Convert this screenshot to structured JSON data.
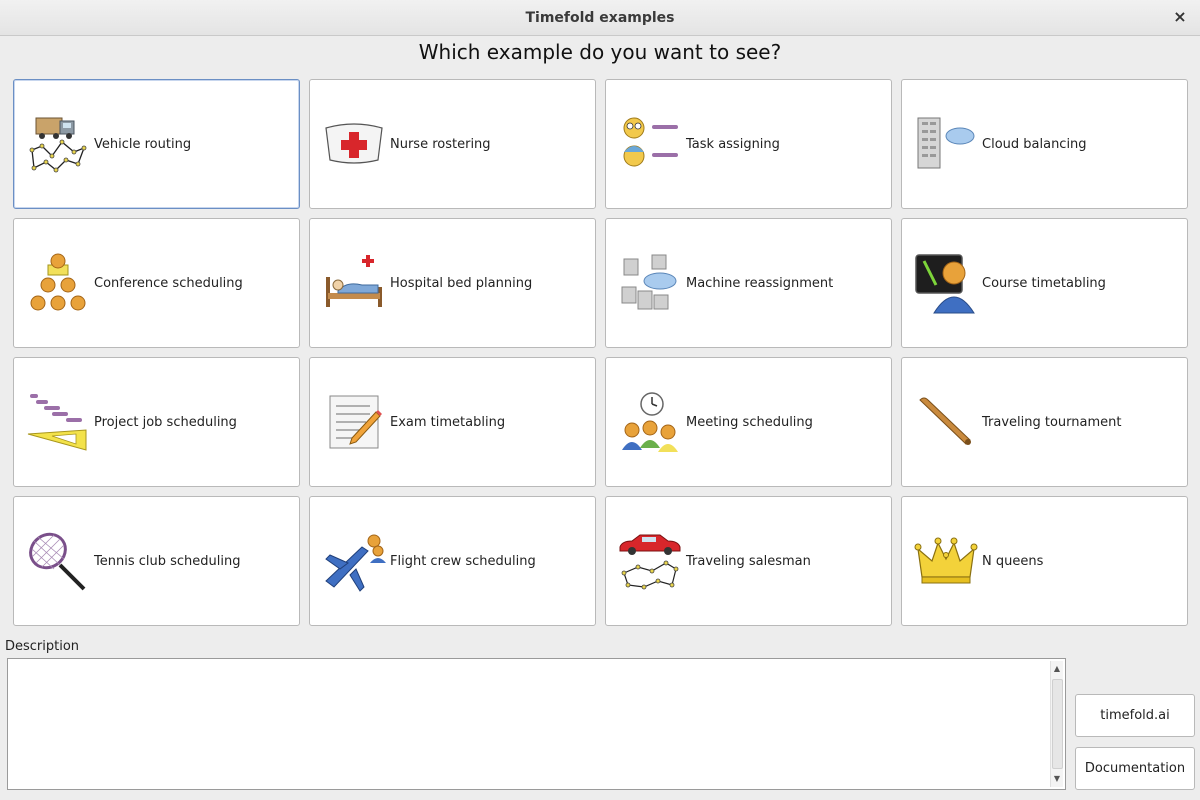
{
  "window": {
    "title": "Timefold examples",
    "close_label": "×"
  },
  "heading": "Which example do you want to see?",
  "examples": [
    {
      "label": "Vehicle routing",
      "icon": "truck-route-icon",
      "selected": true
    },
    {
      "label": "Nurse rostering",
      "icon": "nurse-cap-icon"
    },
    {
      "label": "Task assigning",
      "icon": "task-people-icon"
    },
    {
      "label": "Cloud balancing",
      "icon": "server-cloud-icon"
    },
    {
      "label": "Conference scheduling",
      "icon": "people-pyramid-icon"
    },
    {
      "label": "Hospital bed planning",
      "icon": "hospital-bed-icon"
    },
    {
      "label": "Machine reassignment",
      "icon": "servers-cloud-icon"
    },
    {
      "label": "Course timetabling",
      "icon": "teacher-blackboard-icon"
    },
    {
      "label": "Project job scheduling",
      "icon": "gantt-ruler-icon"
    },
    {
      "label": "Exam timetabling",
      "icon": "exam-paper-pencil-icon"
    },
    {
      "label": "Meeting scheduling",
      "icon": "meeting-clock-icon"
    },
    {
      "label": "Traveling tournament",
      "icon": "baseball-bat-icon"
    },
    {
      "label": "Tennis club scheduling",
      "icon": "tennis-racket-icon"
    },
    {
      "label": "Flight crew scheduling",
      "icon": "airplane-crew-icon"
    },
    {
      "label": "Traveling salesman",
      "icon": "car-route-icon"
    },
    {
      "label": "N queens",
      "icon": "crown-icon"
    }
  ],
  "description": {
    "label": "Description",
    "text": ""
  },
  "buttons": {
    "website": "timefold.ai",
    "documentation": "Documentation"
  },
  "colors": {
    "selected_border": "#6b8fc4",
    "tile_border": "#b9b9b9",
    "background": "#ededed"
  }
}
